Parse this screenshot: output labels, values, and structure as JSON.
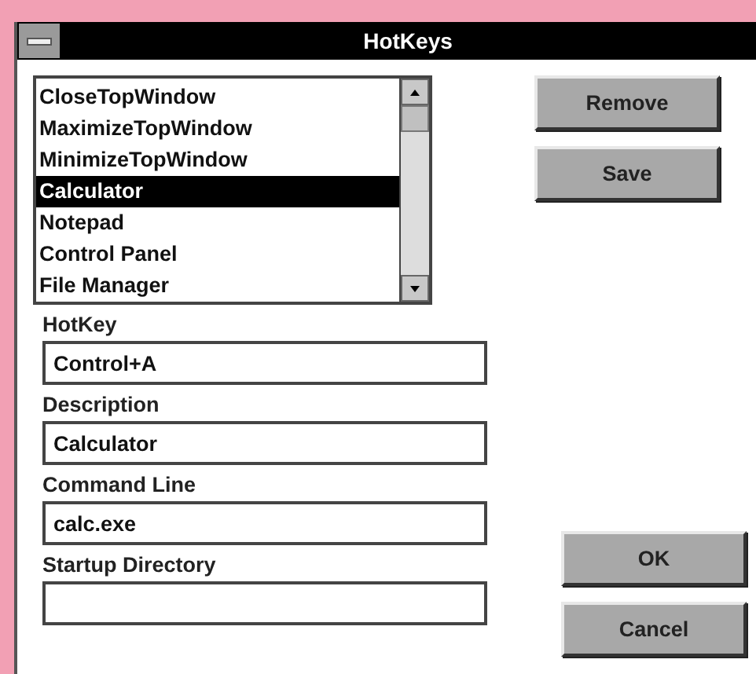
{
  "window": {
    "title": "HotKeys"
  },
  "list": {
    "items": [
      {
        "label": "CloseTopWindow",
        "selected": false
      },
      {
        "label": "MaximizeTopWindow",
        "selected": false
      },
      {
        "label": "MinimizeTopWindow",
        "selected": false
      },
      {
        "label": "Calculator",
        "selected": true
      },
      {
        "label": "Notepad",
        "selected": false
      },
      {
        "label": "Control Panel",
        "selected": false
      },
      {
        "label": "File Manager",
        "selected": false
      }
    ]
  },
  "fields": [
    {
      "label": "HotKey",
      "value": "Control+A"
    },
    {
      "label": "Description",
      "value": "Calculator"
    },
    {
      "label": "Command Line",
      "value": "calc.exe"
    },
    {
      "label": "Startup Directory"
    }
  ],
  "top_buttons": [
    "Remove",
    "Save"
  ],
  "bottom_buttons": [
    "OK",
    "Cancel"
  ]
}
